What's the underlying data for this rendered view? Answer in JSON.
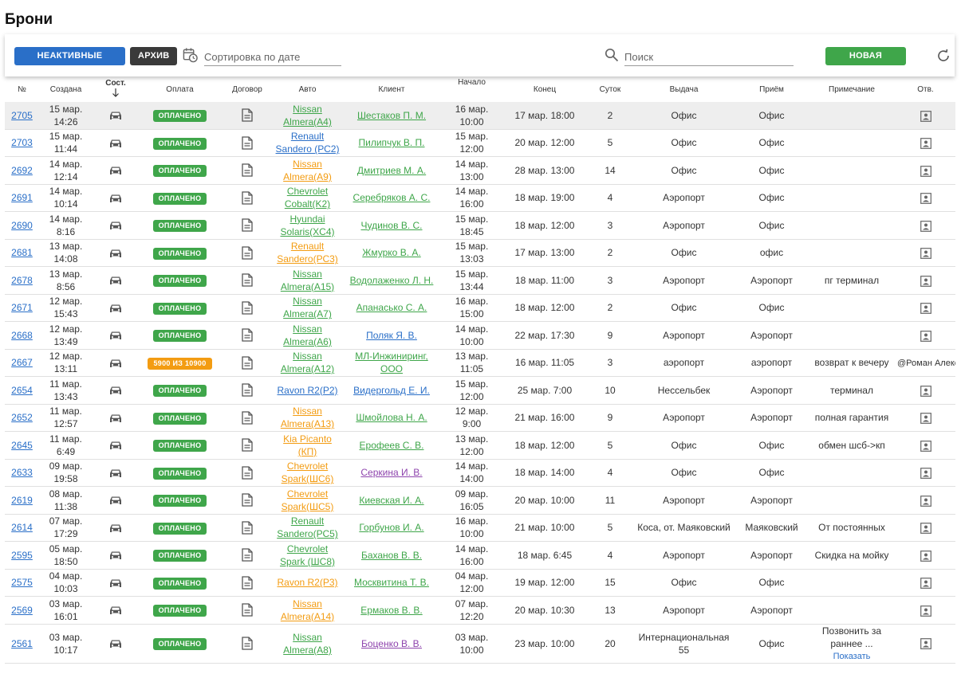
{
  "page": {
    "title": "Брони"
  },
  "toolbar": {
    "inactive_label": "НЕАКТИВНЫЕ БРОНИ",
    "archive_label": "АРХИВ",
    "sort_placeholder": "Сортировка по дате",
    "search_placeholder": "Поиск",
    "new_label": "НОВАЯ БРОНЬ"
  },
  "colors": {
    "blue": "#2a6fc8",
    "green": "#3fa64a",
    "orange": "#f39c12",
    "dark": "#3a3a3a",
    "purple": "#8e44ad"
  },
  "headers": [
    "№",
    "Создана",
    "Сост.",
    "Оплата",
    "Договор",
    "Авто",
    "Клиент",
    "Начало",
    "Конец",
    "Суток",
    "Выдача",
    "Приём",
    "Примечание",
    "Отв."
  ],
  "rows": [
    {
      "id": "2705",
      "created_date": "15 мар.",
      "created_time": "14:26",
      "payment": "ОПЛАЧЕНО",
      "pay_type": "paid",
      "car": "Nissan Almera(A4)",
      "car_color": "green",
      "client": "Шестаков П. М.",
      "client_color": "green",
      "start_date": "16 мар.",
      "start_time": "10:00",
      "end": "17 мар. 18:00",
      "days": "2",
      "pickup": "Офис",
      "dropoff": "Офис",
      "note": "",
      "resp": ""
    },
    {
      "id": "2703",
      "created_date": "15 мар.",
      "created_time": "11:44",
      "payment": "ОПЛАЧЕНО",
      "pay_type": "paid",
      "car": "Renault Sandero (РС2)",
      "car_color": "blue",
      "client": "Пилипчук В. П.",
      "client_color": "green",
      "start_date": "15 мар.",
      "start_time": "12:00",
      "end": "20 мар. 12:00",
      "days": "5",
      "pickup": "Офис",
      "dropoff": "Офис",
      "note": "",
      "resp": ""
    },
    {
      "id": "2692",
      "created_date": "14 мар.",
      "created_time": "12:14",
      "payment": "ОПЛАЧЕНО",
      "pay_type": "paid",
      "car": "Nissan Almera(A9)",
      "car_color": "orange",
      "client": "Дмитриев М. А.",
      "client_color": "green",
      "start_date": "14 мар.",
      "start_time": "13:00",
      "end": "28 мар. 13:00",
      "days": "14",
      "pickup": "Офис",
      "dropoff": "Офис",
      "note": "",
      "resp": ""
    },
    {
      "id": "2691",
      "created_date": "14 мар.",
      "created_time": "10:14",
      "payment": "ОПЛАЧЕНО",
      "pay_type": "paid",
      "car": "Chevrolet Cobalt(K2)",
      "car_color": "green",
      "client": "Серебряков А. С.",
      "client_color": "green",
      "start_date": "14 мар.",
      "start_time": "16:00",
      "end": "18 мар. 19:00",
      "days": "4",
      "pickup": "Аэропорт",
      "dropoff": "Офис",
      "note": "",
      "resp": ""
    },
    {
      "id": "2690",
      "created_date": "14 мар.",
      "created_time": "8:16",
      "payment": "ОПЛАЧЕНО",
      "pay_type": "paid",
      "car": "Hyundai Solaris(XC4)",
      "car_color": "green",
      "client": "Чудинов В. С.",
      "client_color": "green",
      "start_date": "15 мар.",
      "start_time": "18:45",
      "end": "18 мар. 12:00",
      "days": "3",
      "pickup": "Аэропорт",
      "dropoff": "Офис",
      "note": "",
      "resp": ""
    },
    {
      "id": "2681",
      "created_date": "13 мар.",
      "created_time": "14:08",
      "payment": "ОПЛАЧЕНО",
      "pay_type": "paid",
      "car": "Renault Sandero(РС3)",
      "car_color": "orange",
      "client": "Жмурко В. А.",
      "client_color": "green",
      "start_date": "15 мар.",
      "start_time": "13:03",
      "end": "17 мар. 13:00",
      "days": "2",
      "pickup": "Офис",
      "dropoff": "офис",
      "note": "",
      "resp": ""
    },
    {
      "id": "2678",
      "created_date": "13 мар.",
      "created_time": "8:56",
      "payment": "ОПЛАЧЕНО",
      "pay_type": "paid",
      "car": "Nissan Almera(A15)",
      "car_color": "green",
      "client": "Водолаженко Л. Н.",
      "client_color": "green",
      "start_date": "15 мар.",
      "start_time": "13:44",
      "end": "18 мар. 11:00",
      "days": "3",
      "pickup": "Аэропорт",
      "dropoff": "Аэропорт",
      "note": "пг терминал",
      "resp": ""
    },
    {
      "id": "2671",
      "created_date": "12 мар.",
      "created_time": "15:43",
      "payment": "ОПЛАЧЕНО",
      "pay_type": "paid",
      "car": "Nissan Almera(A7)",
      "car_color": "green",
      "client": "Апанасько С. А.",
      "client_color": "green",
      "start_date": "16 мар.",
      "start_time": "15:00",
      "end": "18 мар. 12:00",
      "days": "2",
      "pickup": "Офис",
      "dropoff": "Офис",
      "note": "",
      "resp": ""
    },
    {
      "id": "2668",
      "created_date": "12 мар.",
      "created_time": "13:49",
      "payment": "ОПЛАЧЕНО",
      "pay_type": "paid",
      "car": "Nissan Almera(A6)",
      "car_color": "green",
      "client": "Поляк Я. В.",
      "client_color": "blue",
      "start_date": "14 мар.",
      "start_time": "10:00",
      "end": "22 мар. 17:30",
      "days": "9",
      "pickup": "Аэропорт",
      "dropoff": "Аэропорт",
      "note": "",
      "resp": ""
    },
    {
      "id": "2667",
      "created_date": "12 мар.",
      "created_time": "13:11",
      "payment": "5900 ИЗ 10900",
      "pay_type": "partial",
      "car": "Nissan Almera(A12)",
      "car_color": "green",
      "client": "МЛ-Инжиниринг, ООО",
      "client_color": "green",
      "start_date": "13 мар.",
      "start_time": "11:05",
      "end": "16 мар. 11:05",
      "days": "3",
      "pickup": "аэропорт",
      "dropoff": "аэропорт",
      "note": "возврат к вечеру",
      "resp": "@Роман Александрович"
    },
    {
      "id": "2654",
      "created_date": "11 мар.",
      "created_time": "13:43",
      "payment": "ОПЛАЧЕНО",
      "pay_type": "paid",
      "car": "Ravon R2(P2)",
      "car_color": "blue",
      "client": "Видергольд Е. И.",
      "client_color": "blue",
      "start_date": "15 мар.",
      "start_time": "12:00",
      "end": "25 мар. 7:00",
      "days": "10",
      "pickup": "Нессельбек",
      "dropoff": "Аэропорт",
      "note": "терминал",
      "resp": ""
    },
    {
      "id": "2652",
      "created_date": "11 мар.",
      "created_time": "12:57",
      "payment": "ОПЛАЧЕНО",
      "pay_type": "paid",
      "car": "Nissan Almera(A13)",
      "car_color": "orange",
      "client": "Шмойлова Н. А.",
      "client_color": "green",
      "start_date": "12 мар.",
      "start_time": "9:00",
      "end": "21 мар. 16:00",
      "days": "9",
      "pickup": "Аэропорт",
      "dropoff": "Аэропорт",
      "note": "полная гарантия",
      "resp": ""
    },
    {
      "id": "2645",
      "created_date": "11 мар.",
      "created_time": "6:49",
      "payment": "ОПЛАЧЕНО",
      "pay_type": "paid",
      "car": "Kia Picanto (КП)",
      "car_color": "orange",
      "client": "Ерофеев С. В.",
      "client_color": "green",
      "start_date": "13 мар.",
      "start_time": "12:00",
      "end": "18 мар. 12:00",
      "days": "5",
      "pickup": "Офис",
      "dropoff": "Офис",
      "note": "обмен шсб->кп",
      "resp": ""
    },
    {
      "id": "2633",
      "created_date": "09 мар.",
      "created_time": "19:58",
      "payment": "ОПЛАЧЕНО",
      "pay_type": "paid",
      "car": "Chevrolet Spark(ШС6)",
      "car_color": "orange",
      "client": "Серкина И. В.",
      "client_color": "purple",
      "start_date": "14 мар.",
      "start_time": "14:00",
      "end": "18 мар. 14:00",
      "days": "4",
      "pickup": "Офис",
      "dropoff": "Офис",
      "note": "",
      "resp": ""
    },
    {
      "id": "2619",
      "created_date": "08 мар.",
      "created_time": "11:38",
      "payment": "ОПЛАЧЕНО",
      "pay_type": "paid",
      "car": "Chevrolet Spark(ШС5)",
      "car_color": "orange",
      "client": "Киевская И. А.",
      "client_color": "green",
      "start_date": "09 мар.",
      "start_time": "16:05",
      "end": "20 мар. 10:00",
      "days": "11",
      "pickup": "Аэропорт",
      "dropoff": "Аэропорт",
      "note": "",
      "resp": ""
    },
    {
      "id": "2614",
      "created_date": "07 мар.",
      "created_time": "17:29",
      "payment": "ОПЛАЧЕНО",
      "pay_type": "paid",
      "car": "Renault Sandero(РС5)",
      "car_color": "green",
      "client": "Горбунов И. А.",
      "client_color": "green",
      "start_date": "16 мар.",
      "start_time": "10:00",
      "end": "21 мар. 10:00",
      "days": "5",
      "pickup": "Коса, от. Маяковский",
      "dropoff": "Маяковский",
      "note": "От постоянных",
      "resp": ""
    },
    {
      "id": "2595",
      "created_date": "05 мар.",
      "created_time": "18:50",
      "payment": "ОПЛАЧЕНО",
      "pay_type": "paid",
      "car": "Chevrolet Spark (ШС8)",
      "car_color": "green",
      "client": "Баханов В. В.",
      "client_color": "green",
      "start_date": "14 мар.",
      "start_time": "16:00",
      "end": "18 мар. 6:45",
      "days": "4",
      "pickup": "Аэропорт",
      "dropoff": "Аэропорт",
      "note": "Скидка на мойку",
      "resp": ""
    },
    {
      "id": "2575",
      "created_date": "04 мар.",
      "created_time": "10:03",
      "payment": "ОПЛАЧЕНО",
      "pay_type": "paid",
      "car": "Ravon R2(P3)",
      "car_color": "orange",
      "client": "Москвитина Т. В.",
      "client_color": "green",
      "start_date": "04 мар.",
      "start_time": "12:00",
      "end": "19 мар. 12:00",
      "days": "15",
      "pickup": "Офис",
      "dropoff": "Офис",
      "note": "",
      "resp": ""
    },
    {
      "id": "2569",
      "created_date": "03 мар.",
      "created_time": "16:01",
      "payment": "ОПЛАЧЕНО",
      "pay_type": "paid",
      "car": "Nissan Almera(A14)",
      "car_color": "orange",
      "client": "Ермаков В. В.",
      "client_color": "green",
      "start_date": "07 мар.",
      "start_time": "12:20",
      "end": "20 мар. 10:30",
      "days": "13",
      "pickup": "Аэропорт",
      "dropoff": "Аэропорт",
      "note": "",
      "resp": ""
    },
    {
      "id": "2561",
      "created_date": "03 мар.",
      "created_time": "10:17",
      "payment": "ОПЛАЧЕНО",
      "pay_type": "paid",
      "car": "Nissan Almera(A8)",
      "car_color": "green",
      "client": "Боценко В. В.",
      "client_color": "purple",
      "start_date": "03 мар.",
      "start_time": "10:00",
      "end": "23 мар. 10:00",
      "days": "20",
      "pickup": "Интернациональная 55",
      "dropoff": "Офис",
      "note": "Позвонить за раннее ...",
      "note_link": "Показать",
      "resp": ""
    }
  ]
}
